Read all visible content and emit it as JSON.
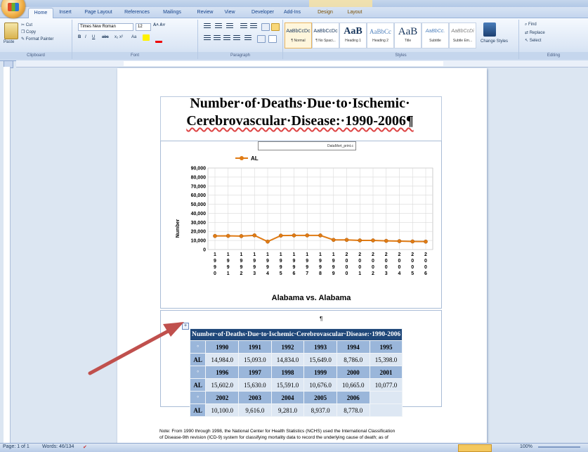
{
  "ribbon": {
    "tabs": [
      "Home",
      "Insert",
      "Page Layout",
      "References",
      "Mailings",
      "Review",
      "View",
      "Developer",
      "Add-Ins",
      "Design",
      "Layout"
    ],
    "clipboard": {
      "paste": "Paste",
      "cut": "Cut",
      "copy": "Copy",
      "format_painter": "Format Painter",
      "label": "Clipboard"
    },
    "font": {
      "name": "Times New Roman",
      "size": "12",
      "label": "Font"
    },
    "paragraph_label": "Paragraph",
    "styles": [
      {
        "preview": "AaBbCcDc",
        "name": "¶ Normal"
      },
      {
        "preview": "AaBbCcDc",
        "name": "¶ No Spaci..."
      },
      {
        "preview": "AaB",
        "name": "Heading 1"
      },
      {
        "preview": "AaBbCc",
        "name": "Heading 2"
      },
      {
        "preview": "AaB",
        "name": "Title"
      },
      {
        "preview": "AaBbCc.",
        "name": "Subtitle"
      },
      {
        "preview": "AaBbCcDi",
        "name": "Subtle Em..."
      }
    ],
    "styles_label": "Styles",
    "change_styles": "Change Styles",
    "editing": {
      "find": "Find",
      "replace": "Replace",
      "select": "Select",
      "label": "Editing"
    }
  },
  "document": {
    "title_line1": "Number·of·Deaths·Due·to·Ischemic·",
    "title_line2": "Cerebrovascular·Disease:·1990-2006¶",
    "chart_box_label": "DataMort_print.c",
    "paragraph_mark": "¶",
    "note_line1": "Note: From 1990 through 1998, the National Center for Health Statistics (NCHS) used the International Classification",
    "note_line2": "of Disease-9th revision (ICD-9) system for classifying mortality data to record the underlying cause of death; as of"
  },
  "chart_data": {
    "type": "line",
    "title": "Alabama vs. Alabama",
    "ylabel": "Number",
    "xlabel": "",
    "legend": "AL",
    "legend_position": "top",
    "ylim": [
      0,
      90000
    ],
    "yticks": [
      "90,000",
      "80,000",
      "70,000",
      "60,000",
      "50,000",
      "40,000",
      "30,000",
      "20,000",
      "10,000",
      "0"
    ],
    "x": [
      "1990",
      "1991",
      "1992",
      "1993",
      "1994",
      "1995",
      "1996",
      "1997",
      "1998",
      "1999",
      "2000",
      "2001",
      "2002",
      "2003",
      "2004",
      "2005",
      "2006"
    ],
    "series": [
      {
        "name": "AL",
        "color": "#e07b14",
        "values": [
          14984,
          15093,
          14834,
          15649,
          8786,
          15398,
          15602,
          15630,
          15591,
          10676,
          10665,
          10077,
          10100,
          9616,
          9281,
          8937,
          8778
        ]
      }
    ],
    "grid": true
  },
  "table": {
    "caption": "Number·of·Deaths·Due·to·Ischemic·Cerebrovascular·Disease:·1990-2006",
    "rows": [
      {
        "type": "year",
        "cells": [
          "1990",
          "1991",
          "1992",
          "1993",
          "1994",
          "1995"
        ]
      },
      {
        "type": "data",
        "label": "AL",
        "cells": [
          "14,984.0",
          "15,093.0",
          "14,834.0",
          "15,649.0",
          "8,786.0",
          "15,398.0"
        ]
      },
      {
        "type": "year",
        "cells": [
          "1996",
          "1997",
          "1998",
          "1999",
          "2000",
          "2001"
        ]
      },
      {
        "type": "data",
        "label": "AL",
        "cells": [
          "15,602.0",
          "15,630.0",
          "15,591.0",
          "10,676.0",
          "10,665.0",
          "10,077.0"
        ]
      },
      {
        "type": "year",
        "cells": [
          "2002",
          "2003",
          "2004",
          "2005",
          "2006",
          ""
        ]
      },
      {
        "type": "data",
        "label": "AL",
        "cells": [
          "10,100.0",
          "9,616.0",
          "9,281.0",
          "8,937.0",
          "8,778.0",
          ""
        ]
      }
    ]
  },
  "status": {
    "page": "Page: 1 of 1",
    "words": "Words: 46/134",
    "zoom": "100%"
  },
  "colors": {
    "arrow": "#c0504d",
    "series": "#e07b14",
    "table_header": "#1f4779"
  }
}
